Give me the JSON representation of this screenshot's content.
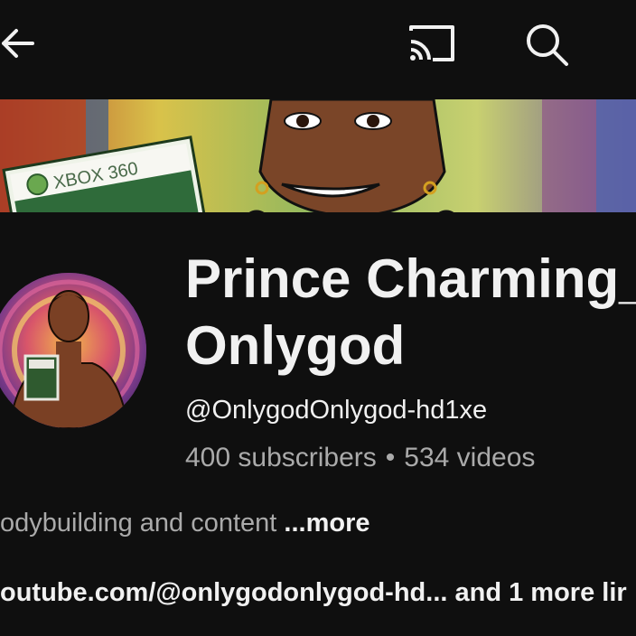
{
  "header": {
    "back_icon": "arrow-left-icon",
    "cast_icon": "cast-icon",
    "search_icon": "search-icon"
  },
  "channel": {
    "name_line1": "Prince Charming_",
    "name_line2": "Onlygod",
    "handle": "@OnlygodOnlygod-hd1xe",
    "subscribers": "400 subscribers",
    "separator": "•",
    "videos": "534 videos",
    "description": "odybuilding and content ",
    "description_more": "...more",
    "link_url": "outube.com/@onlygodonlygod-hd...",
    "link_more": " and 1 more lir"
  },
  "banner": {
    "box_label": "XBOX 360"
  },
  "colors": {
    "background": "#0f0f0f",
    "text_primary": "#f1f1f1",
    "text_secondary": "#aaaaaa"
  }
}
